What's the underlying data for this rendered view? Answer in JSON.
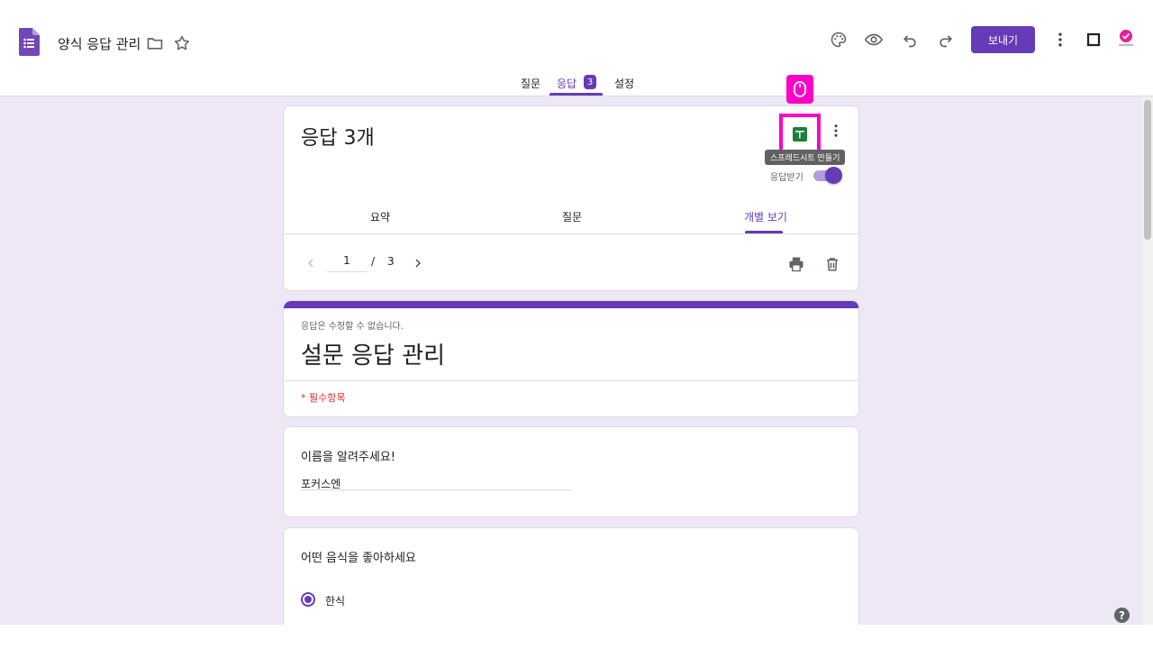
{
  "header": {
    "doc_title": "양식 응답 관리",
    "send_label": "보내기",
    "icons": [
      "folder-icon",
      "star-icon",
      "palette-icon",
      "eye-icon",
      "undo-icon",
      "redo-icon",
      "more-vert-icon",
      "square-icon"
    ]
  },
  "tabs": {
    "questions": "질문",
    "responses": "응답",
    "responses_count": "3",
    "settings": "설정"
  },
  "responses_card": {
    "title": "응답 3개",
    "sheet_tooltip": "스프레드시트 만들기",
    "accept_label": "응답받기",
    "accepting": true,
    "subtabs": {
      "summary": "요약",
      "question": "질문",
      "individual": "개별 보기"
    },
    "pager": {
      "current": "1",
      "separator": "/",
      "total": "3"
    }
  },
  "form_header": {
    "note": "응답은 수정할 수 없습니다.",
    "title": "설문 응답 관리",
    "required_note": "* 필수항목"
  },
  "question1": {
    "title": "이름을 알려주세요!",
    "answer": "포커스엔"
  },
  "question2": {
    "title": "어떤 음식을 좋아하세요",
    "option1": "한식"
  },
  "colors": {
    "accent": "#673ab7",
    "highlight": "#ff00c8",
    "background": "#ede7f6",
    "sheets_green": "#188038"
  }
}
